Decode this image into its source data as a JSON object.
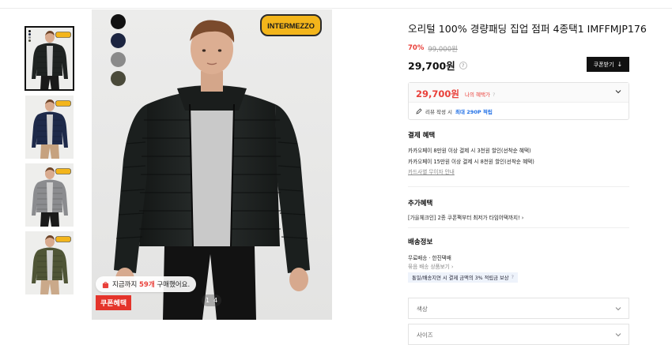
{
  "product": {
    "title": "오리털 100% 경량패딩 집업 점퍼 4종택1 IMFFMJP176",
    "brand_logo_text": "INTERMEZZO",
    "discount_rate": "70%",
    "original_price": "99,000원",
    "price": "29,700원",
    "help_icon": "?",
    "coupon_button_label": "쿠폰받기",
    "coupon_button_icon": "↓"
  },
  "benefit": {
    "price": "29,700원",
    "label": "나의 혜택가",
    "help": "?",
    "review_prefix": "리뷰 작성 시",
    "review_points": "최대 290P 적립"
  },
  "payment": {
    "heading": "결제 혜택",
    "lines": [
      "카카오페이 8만원 이상 결제 시 3천원 할인(선착순 혜택)",
      "카카오페이 15만원 이상 결제 시 8천원 할인(선착순 혜택)"
    ],
    "card_link": "카드사별 무이자 안내"
  },
  "extra": {
    "heading": "추가혜택",
    "line": "[가을체크인] 2종 쿠폰팩부터 최저가 타임어택까지! ›"
  },
  "shipping": {
    "heading": "배송정보",
    "line1": "무료배송 · 한진택배",
    "line2": "묶음 배송 상품보기 ›",
    "badge": "통일/배송지연 시 결제 금액의 3% 적립금 보상",
    "badge_help": "?"
  },
  "options": [
    {
      "label": "색상"
    },
    {
      "label": "사이즈"
    }
  ],
  "image_overlay": {
    "buy_prefix": "지금까지",
    "buy_count": "59개",
    "buy_suffix": "구매했어요.",
    "coupon_tag": "쿠폰혜택",
    "pager_current": "1",
    "pager_total": "4"
  },
  "swatches": [
    "#111111",
    "#1c2541",
    "#8a8a8a",
    "#4a4a3a"
  ],
  "thumbnails": [
    {
      "jacket_color": "#1f2322",
      "selected": true
    },
    {
      "jacket_color": "#1e2a4a",
      "selected": false
    },
    {
      "jacket_color": "#8b8c8f",
      "selected": false
    },
    {
      "jacket_color": "#4f5536",
      "selected": false
    }
  ],
  "colors": {
    "accent_red": "#e9403a",
    "point_blue": "#1f6fe6",
    "logo_yellow": "#f3b51b"
  }
}
